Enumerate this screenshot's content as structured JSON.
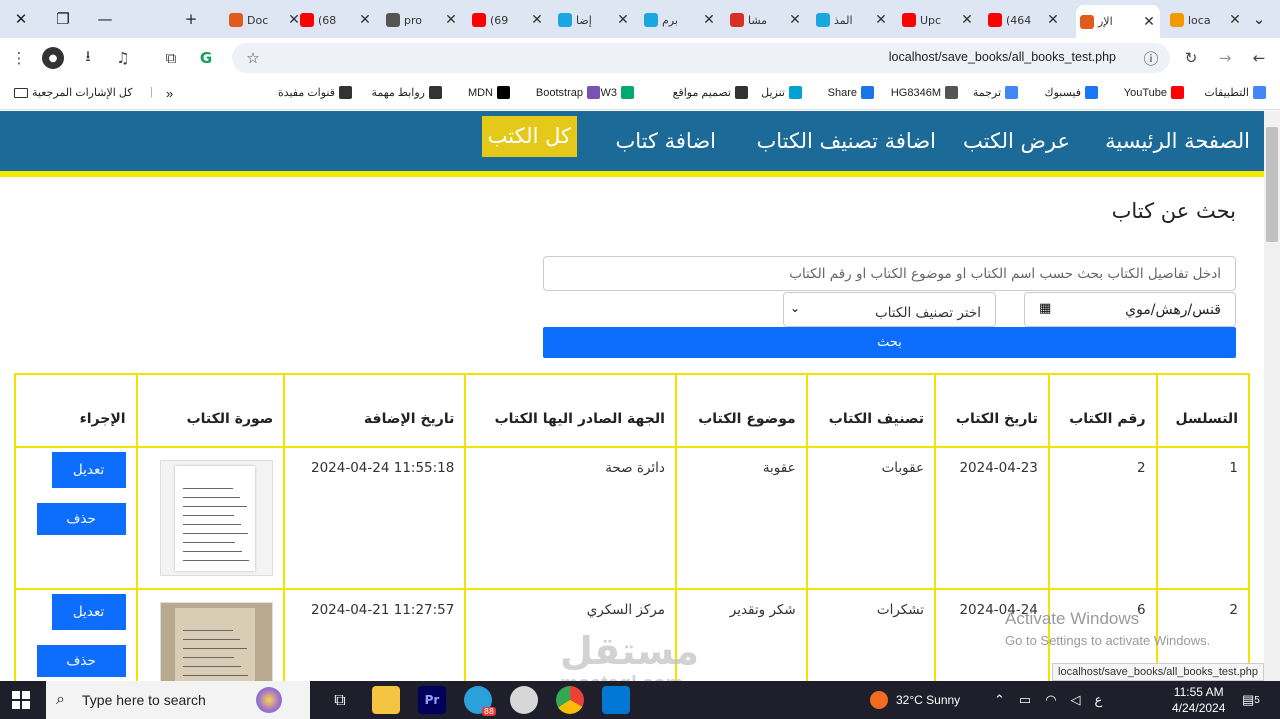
{
  "browser": {
    "tabs": [
      {
        "label": "Doc",
        "color": "#e25a1c"
      },
      {
        "label": "(68",
        "color": "#ff0000"
      },
      {
        "label": "pro",
        "color": "#555555"
      },
      {
        "label": "(69",
        "color": "#ff0000"
      },
      {
        "label": "إضا",
        "color": "#1aa7e0"
      },
      {
        "label": "برم",
        "color": "#1aa7e0"
      },
      {
        "label": "مشا",
        "color": "#d93025"
      },
      {
        "label": "المذ",
        "color": "#1aa7e0"
      },
      {
        "label": "Upc",
        "color": "#ff0000"
      },
      {
        "label": "(464",
        "color": "#ff0000"
      },
      {
        "label": "الإر",
        "color": "#e25a1c"
      },
      {
        "label": "loca",
        "color": "#f29900"
      }
    ],
    "url": "localhost/save_books/all_books_test.php",
    "bookmarks": [
      {
        "label": "التطبيقات",
        "color": "#4285f4"
      },
      {
        "label": "YouTube",
        "color": "#ff0000"
      },
      {
        "label": "فيسبوك",
        "color": "#1877f2"
      },
      {
        "label": "ترجمة",
        "color": "#4285f4"
      },
      {
        "label": "HG8346M",
        "color": "#555555"
      },
      {
        "label": "Share",
        "color": "#1a73e8"
      },
      {
        "label": "تنزيل",
        "color": "#00a2d4"
      },
      {
        "label": "تصميم مواقع",
        "color": "#333333"
      },
      {
        "label": "W3",
        "color": "#04aa6d"
      },
      {
        "label": "Bootstrap",
        "color": "#7952b3"
      },
      {
        "label": "MDN",
        "color": "#000000"
      },
      {
        "label": "روابط مهمة",
        "color": "#333333"
      },
      {
        "label": "قنوات مفيدة",
        "color": "#333333"
      }
    ],
    "all_bookmarks": "كل الإشارات المرجعية",
    "status_url": "localhost/save_books/all_books_test.php"
  },
  "nav": {
    "items": [
      "الصفحة الرئيسية",
      "عرض الكتب",
      "اضافة تصنيف الكتاب",
      "اضافة كتاب",
      "كل الكتب"
    ],
    "active": "كل الكتب",
    "bg": "#1b6a98",
    "accent": "#f3e800"
  },
  "search": {
    "heading": "بحث عن كتاب",
    "placeholder": "ادخل تفاصيل الكتاب بحث حسب اسم الكتاب او موضوع الكتاب او رقم الكتاب",
    "date_placeholder": "قنس/رهش/موي",
    "category_placeholder": "اختر تصنيف الكتاب",
    "button": "بحث"
  },
  "table": {
    "headers": [
      "التسلسل",
      "رقم الكتاب",
      "تاريخ الكتاب",
      "تصنيف الكتاب",
      "موضوع الكتاب",
      "الجهة الصادر اليها الكتاب",
      "تاريخ الإضافة",
      "صورة الكتاب",
      "الإجراء"
    ],
    "rows": [
      {
        "seq": "1",
        "num": "2",
        "date": "2024-04-23",
        "category": "عقوبات",
        "subject": "عقوبة",
        "dest": "دائرة صحة",
        "added": "2024-04-24 11:55:18"
      },
      {
        "seq": "2",
        "num": "6",
        "date": "2024-04-24",
        "category": "تشكرات",
        "subject": "شكر وتقدير",
        "dest": "مركز السكري",
        "added": "2024-04-21 11:27:57"
      }
    ],
    "edit_label": "تعديل",
    "delete_label": "حذف"
  },
  "watermark": {
    "line1": "Activate Windows",
    "line2": "Go to Settings to activate Windows.",
    "site": "مستقل",
    "site_latin": "mostaql.com"
  },
  "taskbar": {
    "search_placeholder": "Type here to search",
    "weather": "32°C  Sunny",
    "lang": "ع",
    "time": "11:55 AM",
    "date": "4/24/2024",
    "notifications": "5",
    "telegram_badge": "88"
  }
}
